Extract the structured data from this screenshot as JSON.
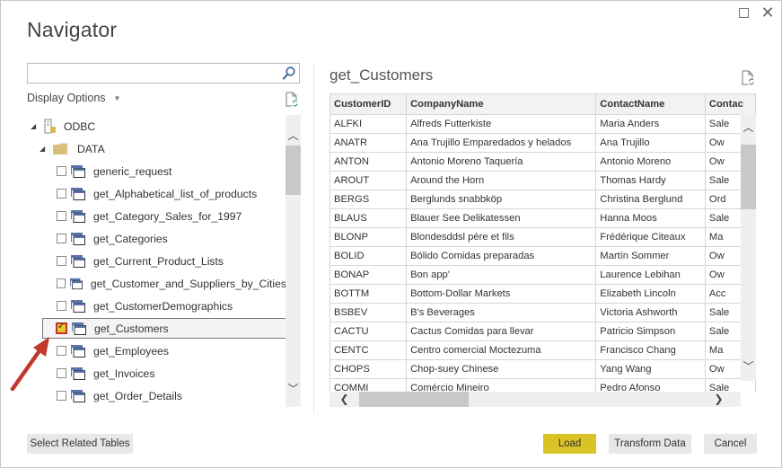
{
  "window": {
    "title": "Navigator",
    "maximize_icon": "maximize-icon",
    "close_icon": "close-icon"
  },
  "left_pane": {
    "search": {
      "value": "",
      "placeholder": "",
      "icon": "search-icon"
    },
    "display_options_label": "Display Options",
    "display_options_icon": "caret-down-icon",
    "refresh_icon": "refresh-icon",
    "tree": {
      "root": {
        "label": "ODBC",
        "icon": "database-server-icon",
        "expanded": true
      },
      "folder": {
        "label": "DATA",
        "icon": "folder-icon",
        "expanded": true
      },
      "items": [
        {
          "label": "generic_request",
          "checked": false
        },
        {
          "label": "get_Alphabetical_list_of_products",
          "checked": false
        },
        {
          "label": "get_Category_Sales_for_1997",
          "checked": false
        },
        {
          "label": "get_Categories",
          "checked": false
        },
        {
          "label": "get_Current_Product_Lists",
          "checked": false
        },
        {
          "label": "get_Customer_and_Suppliers_by_Cities",
          "checked": false
        },
        {
          "label": "get_CustomerDemographics",
          "checked": false
        },
        {
          "label": "get_Customers",
          "checked": true,
          "selected": true
        },
        {
          "label": "get_Employees",
          "checked": false
        },
        {
          "label": "get_Invoices",
          "checked": false
        },
        {
          "label": "get_Order_Details",
          "checked": false
        }
      ]
    },
    "annotation": "red-arrow-pointing-to-checkbox"
  },
  "preview": {
    "title": "get_Customers",
    "refresh_icon": "refresh-icon",
    "columns": [
      "CustomerID",
      "CompanyName",
      "ContactName",
      "Contac"
    ],
    "rows": [
      [
        "ALFKI",
        "Alfreds Futterkiste",
        "Maria Anders",
        "Sale"
      ],
      [
        "ANATR",
        "Ana Trujillo Emparedados y helados",
        "Ana Trujillo",
        "Ow"
      ],
      [
        "ANTON",
        "Antonio Moreno Taquería",
        "Antonio Moreno",
        "Ow"
      ],
      [
        "AROUT",
        "Around the Horn",
        "Thomas Hardy",
        "Sale"
      ],
      [
        "BERGS",
        "Berglunds snabbköp",
        "Christina Berglund",
        "Ord"
      ],
      [
        "BLAUS",
        "Blauer See Delikatessen",
        "Hanna Moos",
        "Sale"
      ],
      [
        "BLONP",
        "Blondesddsl père et fils",
        "Frédérique Citeaux",
        "Ma"
      ],
      [
        "BOLID",
        "Bólido Comidas preparadas",
        "Martín Sommer",
        "Ow"
      ],
      [
        "BONAP",
        "Bon app'",
        "Laurence Lebihan",
        "Ow"
      ],
      [
        "BOTTM",
        "Bottom-Dollar Markets",
        "Elizabeth Lincoln",
        "Acc"
      ],
      [
        "BSBEV",
        "B's Beverages",
        "Victoria Ashworth",
        "Sale"
      ],
      [
        "CACTU",
        "Cactus Comidas para llevar",
        "Patricio Simpson",
        "Sale"
      ],
      [
        "CENTC",
        "Centro comercial Moctezuma",
        "Francisco Chang",
        "Ma"
      ],
      [
        "CHOPS",
        "Chop-suey Chinese",
        "Yang Wang",
        "Ow"
      ],
      [
        "COMMI",
        "Comércio Mineiro",
        "Pedro Afonso",
        "Sale"
      ]
    ]
  },
  "footer": {
    "select_related": "Select Related Tables",
    "load": "Load",
    "transform": "Transform Data",
    "cancel": "Cancel"
  },
  "colors": {
    "load_button": "#d9c327",
    "checkbox_checked_fill": "#e5c82b",
    "checkbox_checked_border": "#c8302a",
    "arrow": "#c0392b"
  }
}
